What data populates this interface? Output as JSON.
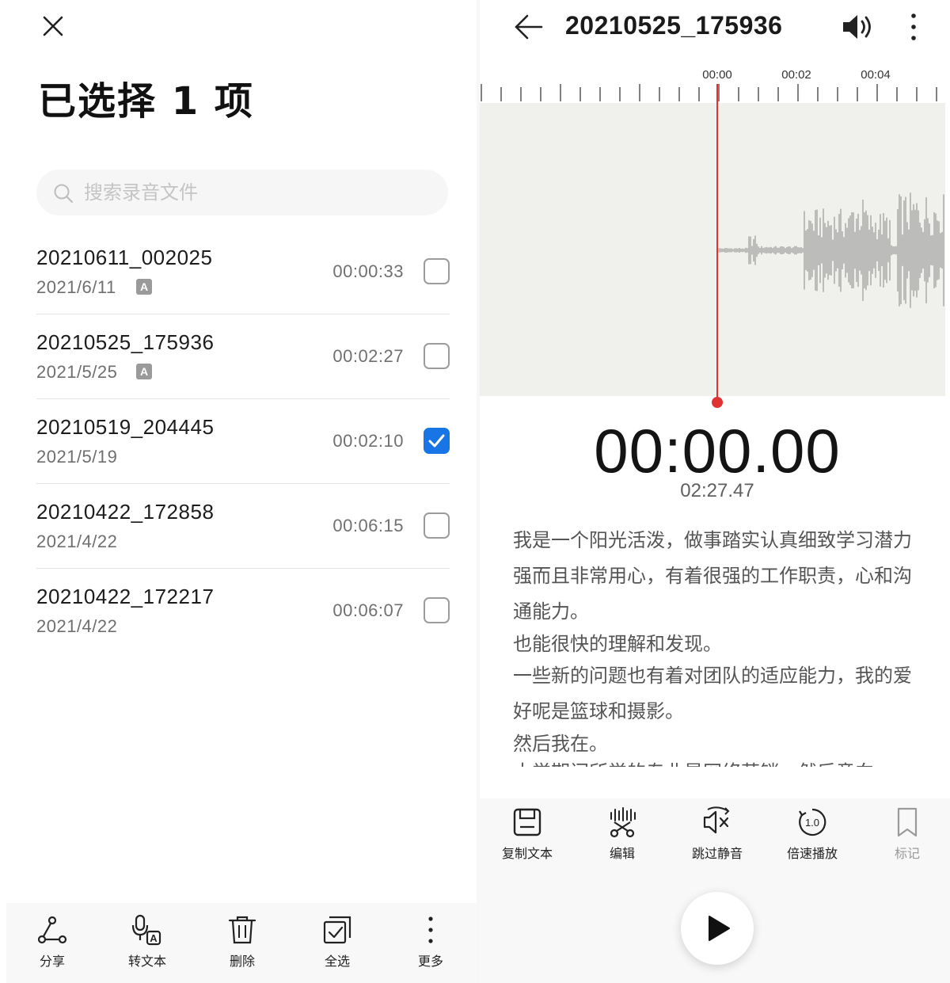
{
  "left": {
    "title": "已选择 1 项",
    "search": {
      "placeholder": "搜索录音文件",
      "value": ""
    },
    "recordings": [
      {
        "name": "20210611_002025",
        "date": "2021/6/11",
        "badge": "A",
        "duration": "00:00:33",
        "checked": false
      },
      {
        "name": "20210525_175936",
        "date": "2021/5/25",
        "badge": "A",
        "duration": "00:02:27",
        "checked": false
      },
      {
        "name": "20210519_204445",
        "date": "2021/5/19",
        "badge": "",
        "duration": "00:02:10",
        "checked": true
      },
      {
        "name": "20210422_172858",
        "date": "2021/4/22",
        "badge": "",
        "duration": "00:06:15",
        "checked": false
      },
      {
        "name": "20210422_172217",
        "date": "2021/4/22",
        "badge": "",
        "duration": "00:06:07",
        "checked": false
      }
    ],
    "bottom_bar": [
      {
        "label": "分享",
        "icon": "share-icon"
      },
      {
        "label": "转文本",
        "icon": "speech-to-text-icon"
      },
      {
        "label": "删除",
        "icon": "trash-icon"
      },
      {
        "label": "全选",
        "icon": "select-all-icon"
      },
      {
        "label": "更多",
        "icon": "more-vertical-icon"
      }
    ]
  },
  "right": {
    "file_name": "20210525_175936",
    "timeline_labels": [
      "00:00",
      "00:02",
      "00:04"
    ],
    "current_time": "00:00.00",
    "total_time": "02:27.47",
    "transcript": [
      "我是一个阳光活泼，做事踏实认真细致学习潜力强而且非常用心，有着很强的工作职责，心和沟通能力。",
      "也能很快的理解和发现。",
      "一些新的问题也有着对团队的适应能力，我的爱好呢是篮球和摄影。",
      "然后我在。",
      "大学期间所学的专业是网络营销，然后意向"
    ],
    "tools": [
      {
        "label": "复制文本",
        "icon": "copy-text-icon",
        "enabled": true
      },
      {
        "label": "编辑",
        "icon": "edit-cut-icon",
        "enabled": true
      },
      {
        "label": "跳过静音",
        "icon": "skip-silence-icon",
        "enabled": true
      },
      {
        "label": "倍速播放",
        "icon": "playback-speed-icon",
        "speed_text": "1.0",
        "enabled": true
      },
      {
        "label": "标记",
        "icon": "bookmark-icon",
        "enabled": false
      }
    ]
  },
  "colors": {
    "accent": "#1775e6",
    "playhead": "#e03232",
    "waveform": "#9a9a9a",
    "waveform_bg": "#f0f1ed"
  }
}
